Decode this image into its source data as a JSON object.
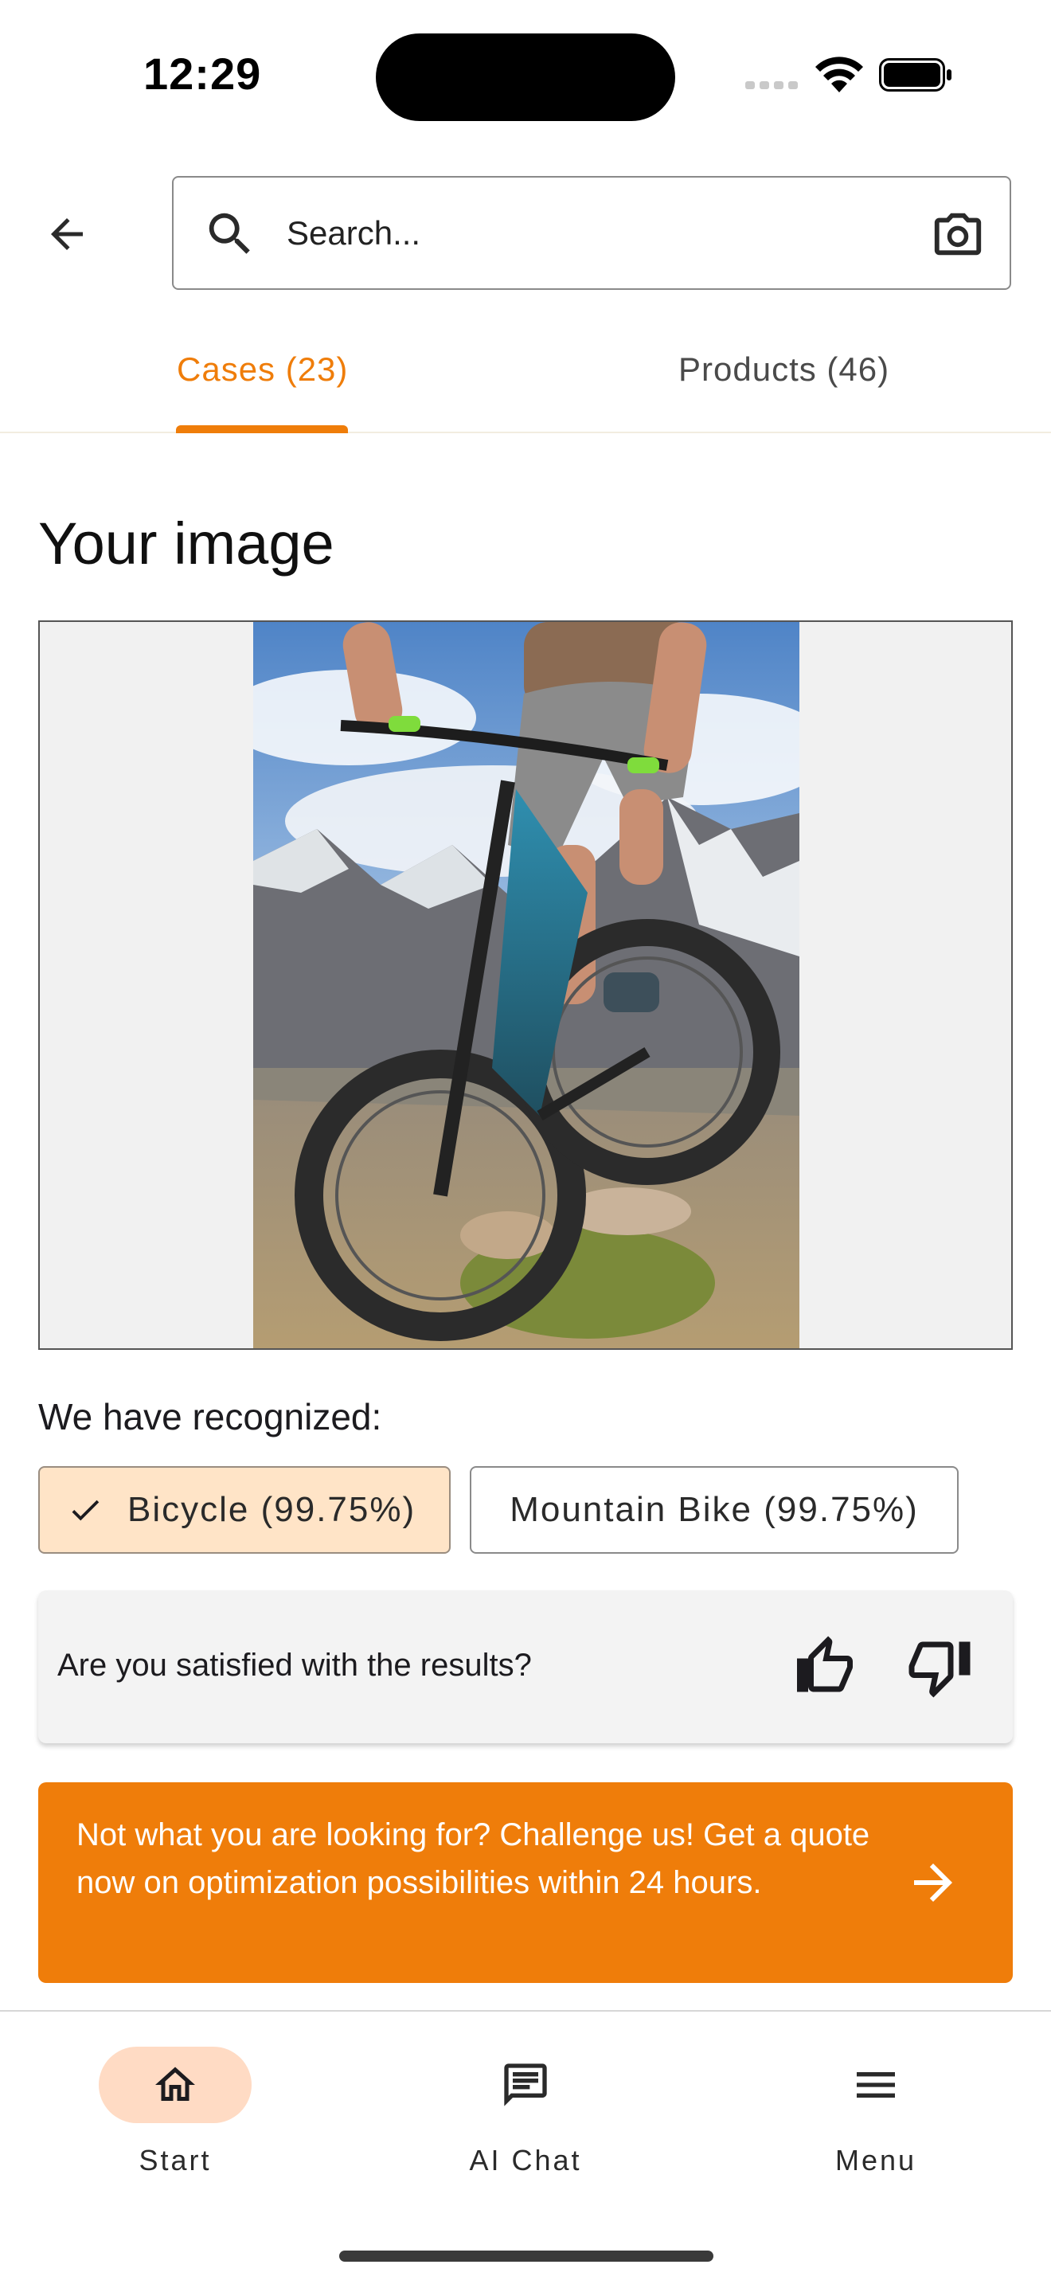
{
  "status_bar": {
    "time": "12:29"
  },
  "header": {
    "back_icon": "arrow-left-icon",
    "search_placeholder": "Search...",
    "search_icon": "search-icon",
    "camera_icon": "camera-icon"
  },
  "tabs": [
    {
      "label": "Cases (23)",
      "active": true
    },
    {
      "label": "Products (46)",
      "active": false
    }
  ],
  "colors": {
    "accent": "#ef7d0a",
    "chip_selected_bg": "#ffe4c7",
    "nav_active_bg": "#ffdbc4"
  },
  "main": {
    "section_title": "Your image",
    "recognized_label": "We have recognized:",
    "chips": [
      {
        "label": "Bicycle (99.75%)",
        "selected": true
      },
      {
        "label": "Mountain Bike (99.75%)",
        "selected": false
      }
    ],
    "feedback": {
      "question": "Are you satisfied with the results?"
    },
    "cta": {
      "text": "Not what you are looking for? Challenge us! Get a quote now on optimization possibilities within 24 hours."
    }
  },
  "bottom_nav": [
    {
      "label": "Start",
      "icon": "home-icon",
      "active": true
    },
    {
      "label": "AI Chat",
      "icon": "chat-icon",
      "active": false
    },
    {
      "label": "Menu",
      "icon": "menu-icon",
      "active": false
    }
  ]
}
